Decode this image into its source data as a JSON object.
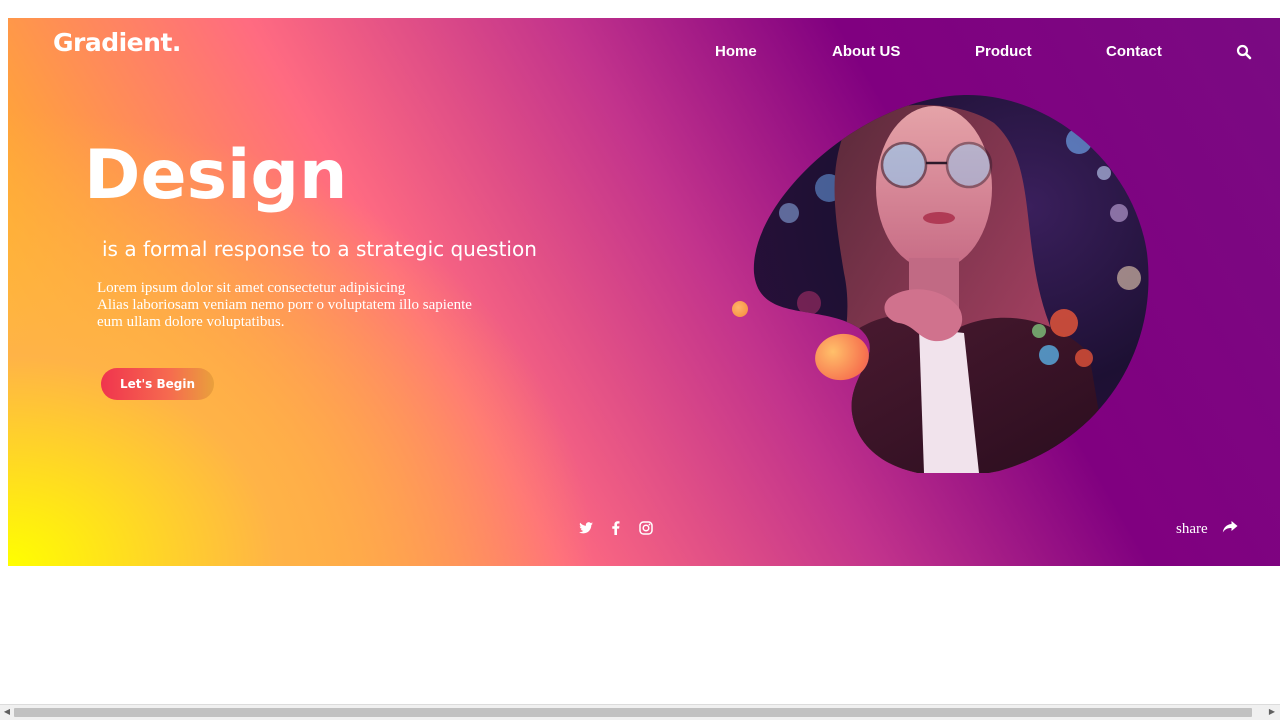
{
  "brand": {
    "logo": "Gradient."
  },
  "nav": {
    "items": [
      {
        "label": "Home"
      },
      {
        "label": "About US"
      },
      {
        "label": "Product"
      },
      {
        "label": "Contact"
      }
    ],
    "search_icon": "search-icon"
  },
  "hero": {
    "headline": "Design",
    "subhead": "is a formal response to a strategic question",
    "body_lines": [
      "Lorem ipsum dolor sit amet consectetur adipisicing",
      "Alias laboriosam veniam nemo porr o voluptatem illo sapiente",
      "eum ullam dolore voluptatibus."
    ],
    "cta_label": "Let's Begin"
  },
  "social": {
    "icons": [
      "twitter-icon",
      "facebook-icon",
      "instagram-icon"
    ]
  },
  "share": {
    "label": "share",
    "icon": "share-arrow-icon"
  },
  "colors": {
    "gradient_start": "#ffff00",
    "gradient_mid": "#ff6b81",
    "gradient_end": "#800080",
    "cta_start": "#f0344e",
    "cta_end": "#e9a03c"
  }
}
